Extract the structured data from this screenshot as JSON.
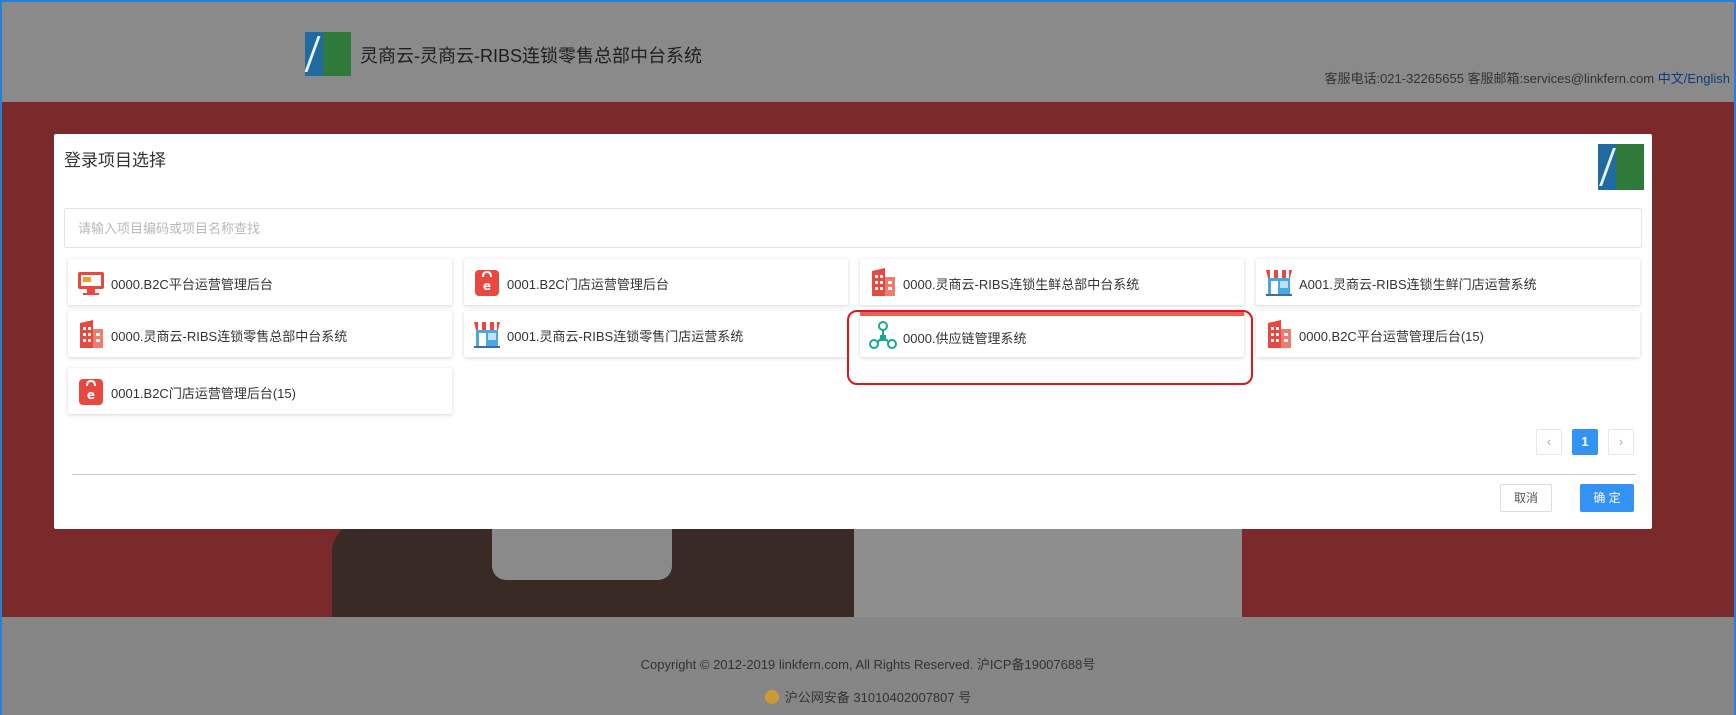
{
  "header": {
    "site_title": "灵商云-灵商云-RIBS连锁零售总部中台系统",
    "contact": "客服电话:021-32265655 客服邮箱:services@linkfern.com",
    "language": "中文/English"
  },
  "modal": {
    "title": "登录项目选择",
    "search_placeholder": "请输入项目编码或项目名称查找",
    "projects": [
      {
        "label": "0000.B2C平台运营管理后台",
        "icon": "monitor-icon"
      },
      {
        "label": "0001.B2C门店运营管理后台",
        "icon": "shopping-bag-icon"
      },
      {
        "label": "0000.灵商云-RIBS连锁生鲜总部中台系统",
        "icon": "building-icon"
      },
      {
        "label": "A001.灵商云-RIBS连锁生鲜门店运营系统",
        "icon": "storefront-icon"
      },
      {
        "label": "0000.灵商云-RIBS连锁零售总部中台系统",
        "icon": "building-icon"
      },
      {
        "label": "0001.灵商云-RIBS连锁零售门店运营系统",
        "icon": "storefront-icon"
      },
      {
        "label": "0000.供应链管理系统",
        "icon": "network-icon",
        "selected": true
      },
      {
        "label": "0000.B2C平台运营管理后台(15)",
        "icon": "building-icon"
      },
      {
        "label": "0001.B2C门店运营管理后台(15)",
        "icon": "shopping-bag-icon"
      }
    ],
    "pagination": {
      "prev": "‹",
      "current": "1",
      "next": "›"
    },
    "cancel_label": "取消",
    "ok_label": "确 定"
  },
  "footer": {
    "copyright": "Copyright © 2012-2019 linkfern.com, All Rights Reserved. 沪ICP备19007688号",
    "police": "沪公网安备 31010402007807 号"
  },
  "colors": {
    "primary": "#3393f5",
    "icon_red": "#e8483f",
    "icon_teal": "#1aa88f",
    "highlight": "#e0161a"
  }
}
